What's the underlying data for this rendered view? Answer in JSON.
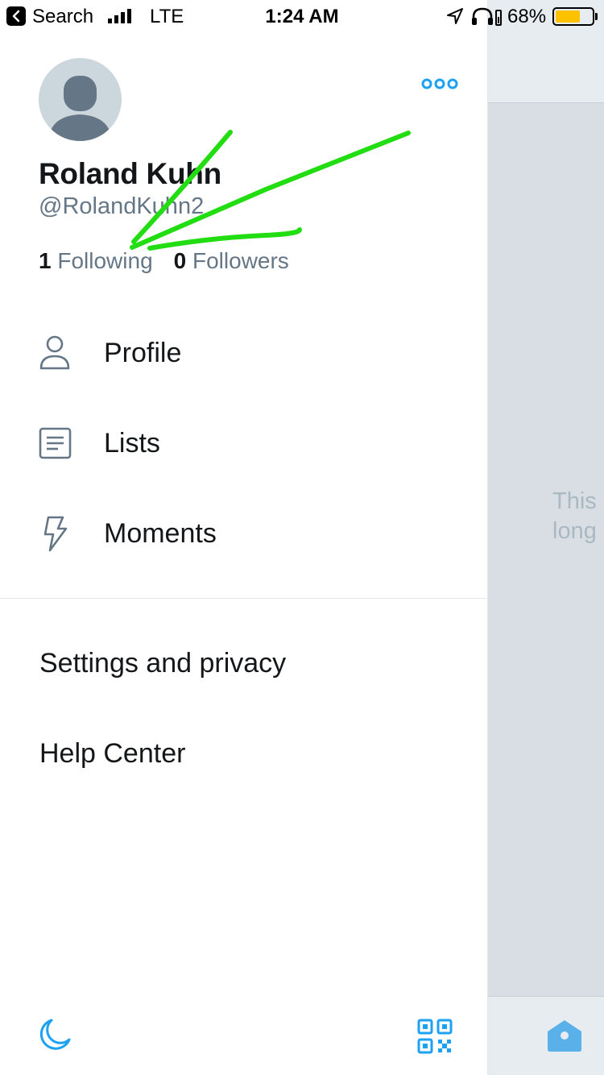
{
  "status_bar": {
    "back_app": "Search",
    "carrier": "LTE",
    "time": "1:24 AM",
    "battery_percent": "68%",
    "battery_level": 0.68,
    "battery_color": "#fcc200"
  },
  "profile": {
    "name": "Roland Kuhn",
    "handle": "@RolandKuhn2",
    "following_count": "1",
    "following_label": "Following",
    "followers_count": "0",
    "followers_label": "Followers"
  },
  "menu": {
    "primary": [
      {
        "label": "Profile",
        "icon": "person-icon"
      },
      {
        "label": "Lists",
        "icon": "list-icon"
      },
      {
        "label": "Moments",
        "icon": "lightning-icon"
      }
    ],
    "secondary": [
      {
        "label": "Settings and privacy"
      },
      {
        "label": "Help Center"
      }
    ]
  },
  "background": {
    "empty_text_line1": "This",
    "empty_text_line2": "long"
  },
  "colors": {
    "accent": "#1da1f2",
    "annotation": "#22dd11",
    "muted": "#657786"
  },
  "icons": {
    "more": "more-options-icon",
    "night_mode": "moon-icon",
    "qr_code": "qr-code-icon",
    "home": "home-icon"
  }
}
